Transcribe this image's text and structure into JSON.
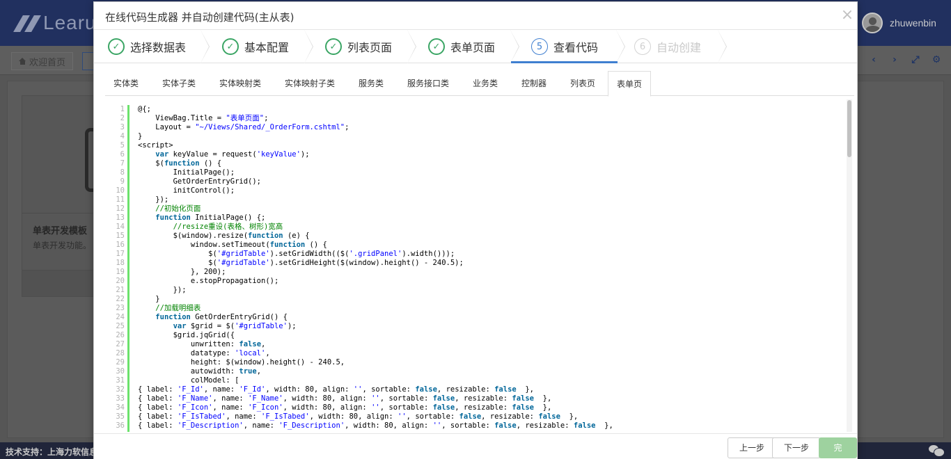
{
  "background": {
    "logo_text": "Learu",
    "user_name": "zhuwenbin",
    "home_tab": "欢迎首页",
    "card_title": "单表开发模板",
    "card_desc": "单表开发功能。",
    "footer_text": "技术支持：上海力软信息",
    "nav_icons": [
      "chevron-left-icon",
      "chevron-right-icon",
      "expand-icon",
      "gear-icon"
    ]
  },
  "modal": {
    "title": "在线代码生成器 并自动创建代码(主从表)",
    "close_symbol": "×"
  },
  "steps": [
    {
      "label": "选择数据表",
      "state": "done",
      "marker": "✓"
    },
    {
      "label": "基本配置",
      "state": "done",
      "marker": "✓"
    },
    {
      "label": "列表页面",
      "state": "done",
      "marker": "✓"
    },
    {
      "label": "表单页面",
      "state": "done",
      "marker": "✓"
    },
    {
      "label": "查看代码",
      "state": "active",
      "marker": "5"
    },
    {
      "label": "自动创建",
      "state": "disabled",
      "marker": "6"
    }
  ],
  "code_tabs": [
    "实体类",
    "实体子类",
    "实体映射类",
    "实体映射子类",
    "服务类",
    "服务接口类",
    "业务类",
    "控制器",
    "列表页",
    "表单页"
  ],
  "active_code_tab": "表单页",
  "code_lines": [
    "@{;",
    "    ViewBag.Title = \"表单页面\";",
    "    Layout = \"~/Views/Shared/_OrderForm.cshtml\";",
    "}",
    "<script>",
    "    var keyValue = request('keyValue');",
    "    $(function () {",
    "        InitialPage();",
    "        GetOrderEntryGrid();",
    "        initControl();",
    "    });",
    "    //初始化页面",
    "    function InitialPage() {;",
    "        //resize重设(表格、树形)宽高",
    "        $(window).resize(function (e) {",
    "            window.setTimeout(function () {",
    "                $('#gridTable').setGridWidth(($('.gridPanel').width()));",
    "                $('#gridTable').setGridHeight($(window).height() - 240.5);",
    "            }, 200);",
    "            e.stopPropagation();",
    "        });",
    "    }",
    "    //加载明细表",
    "    function GetOrderEntryGrid() {",
    "        var $grid = $('#gridTable');",
    "        $grid.jqGrid({",
    "            unwritten: false,",
    "            datatype: 'local',",
    "            height: $(window).height() - 240.5,",
    "            autowidth: true,",
    "            colModel: [",
    "{ label: 'F_Id', name: 'F_Id', width: 80, align: '', sortable: false, resizable: false  },",
    "{ label: 'F_Name', name: 'F_Name', width: 80, align: '', sortable: false, resizable: false  },",
    "{ label: 'F_Icon', name: 'F_Icon', width: 80, align: '', sortable: false, resizable: false  },",
    "{ label: 'F_IsTabed', name: 'F_IsTabed', width: 80, align: '', sortable: false, resizable: false  },",
    "{ label: 'F_Description', name: 'F_Description', width: 80, align: '', sortable: false, resizable: false  },"
  ],
  "buttons": {
    "prev": "上一步",
    "next": "下一步",
    "finish": "完成"
  },
  "colors": {
    "done": "#3aa564",
    "active": "#3f7fd0",
    "gutter": "#6ce26c",
    "keyword": "#006699",
    "string": "#0000ff",
    "comment": "#008200"
  }
}
